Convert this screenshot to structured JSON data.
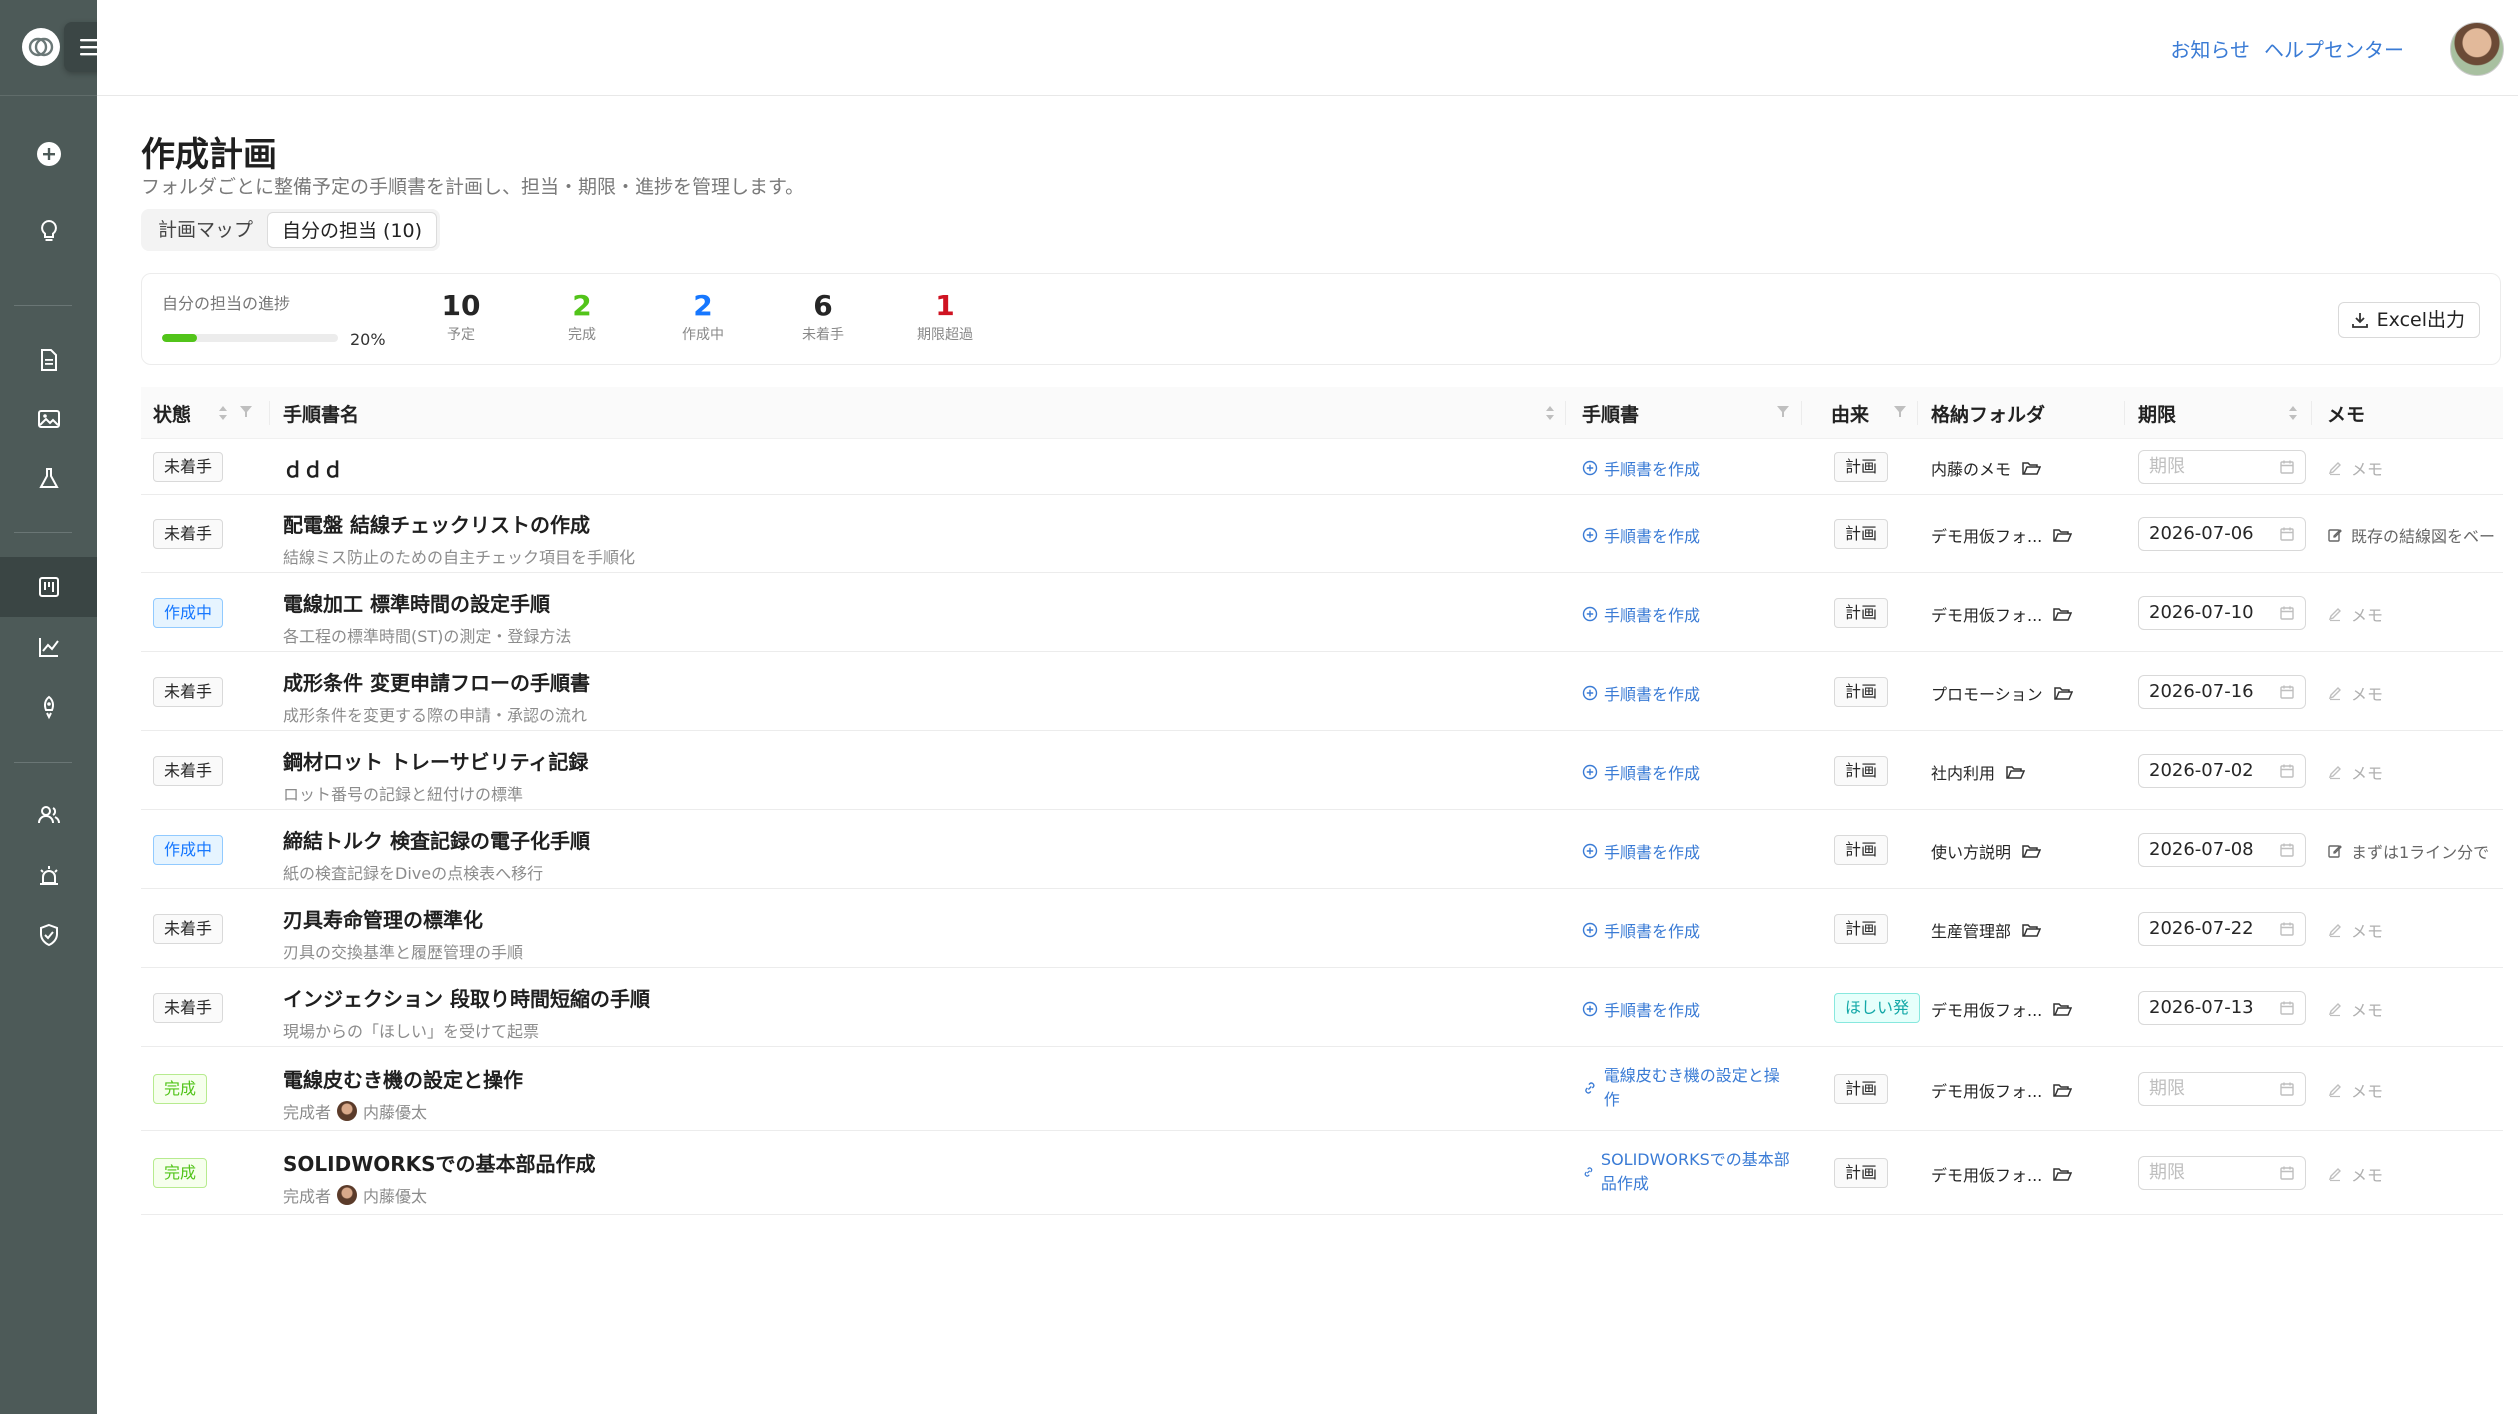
{
  "header": {
    "notice": "お知らせ",
    "help": "ヘルプセンター"
  },
  "page": {
    "title": "作成計画",
    "description": "フォルダごとに整備予定の手順書を計画し、担当・期限・進捗を管理します。",
    "tabs": [
      "計画マップ",
      "自分の担当 (10)"
    ],
    "active_tab": 1
  },
  "progress": {
    "label": "自分の担当の進捗",
    "percent_text": "20%",
    "fraction": 0.2
  },
  "stats": [
    {
      "value": "10",
      "label": "予定",
      "color": "#262626"
    },
    {
      "value": "2",
      "label": "完成",
      "color": "#52c41a"
    },
    {
      "value": "2",
      "label": "作成中",
      "color": "#1677ff"
    },
    {
      "value": "6",
      "label": "未着手",
      "color": "#262626"
    },
    {
      "value": "1",
      "label": "期限超過",
      "color": "#cf1322"
    }
  ],
  "excel_button": "Excel出力",
  "table": {
    "headers": {
      "status": "状態",
      "name": "手順書名",
      "doc": "手順書",
      "origin": "由来",
      "folder": "格納フォルダ",
      "deadline": "期限",
      "memo": "メモ"
    },
    "rows": [
      {
        "status": "未着手",
        "status_kind": "todo",
        "title": "ｄｄｄ",
        "sub": "",
        "completer": "",
        "doc": "手順書を作成",
        "doc_kind": "create",
        "origin": "計画",
        "origin_kind": "plan",
        "folder": "内藤のメモ",
        "date": "期限",
        "date_empty": true,
        "memo": "メモ",
        "memo_filled": false
      },
      {
        "status": "未着手",
        "status_kind": "todo",
        "title": "配電盤 結線チェックリストの作成",
        "sub": "結線ミス防止のための自主チェック項目を手順化",
        "completer": "",
        "doc": "手順書を作成",
        "doc_kind": "create",
        "origin": "計画",
        "origin_kind": "plan",
        "folder": "デモ用仮フォ...",
        "date": "2026-07-06",
        "date_empty": false,
        "memo": "既存の結線図をベー",
        "memo_filled": true
      },
      {
        "status": "作成中",
        "status_kind": "doing",
        "title": "電線加工 標準時間の設定手順",
        "sub": "各工程の標準時間(ST)の測定・登録方法",
        "completer": "",
        "doc": "手順書を作成",
        "doc_kind": "create",
        "origin": "計画",
        "origin_kind": "plan",
        "folder": "デモ用仮フォ...",
        "date": "2026-07-10",
        "date_empty": false,
        "memo": "メモ",
        "memo_filled": false
      },
      {
        "status": "未着手",
        "status_kind": "todo",
        "title": "成形条件 変更申請フローの手順書",
        "sub": "成形条件を変更する際の申請・承認の流れ",
        "completer": "",
        "doc": "手順書を作成",
        "doc_kind": "create",
        "origin": "計画",
        "origin_kind": "plan",
        "folder": "プロモーション",
        "date": "2026-07-16",
        "date_empty": false,
        "memo": "メモ",
        "memo_filled": false
      },
      {
        "status": "未着手",
        "status_kind": "todo",
        "title": "鋼材ロット トレーサビリティ記録",
        "sub": "ロット番号の記録と紐付けの標準",
        "completer": "",
        "doc": "手順書を作成",
        "doc_kind": "create",
        "origin": "計画",
        "origin_kind": "plan",
        "folder": "社内利用",
        "date": "2026-07-02",
        "date_empty": false,
        "memo": "メモ",
        "memo_filled": false
      },
      {
        "status": "作成中",
        "status_kind": "doing",
        "title": "締結トルク 検査記録の電子化手順",
        "sub": "紙の検査記録をDiveの点検表へ移行",
        "completer": "",
        "doc": "手順書を作成",
        "doc_kind": "create",
        "origin": "計画",
        "origin_kind": "plan",
        "folder": "使い方説明",
        "date": "2026-07-08",
        "date_empty": false,
        "memo": "まずは1ライン分で",
        "memo_filled": true
      },
      {
        "status": "未着手",
        "status_kind": "todo",
        "title": "刃具寿命管理の標準化",
        "sub": "刃具の交換基準と履歴管理の手順",
        "completer": "",
        "doc": "手順書を作成",
        "doc_kind": "create",
        "origin": "計画",
        "origin_kind": "plan",
        "folder": "生産管理部",
        "date": "2026-07-22",
        "date_empty": false,
        "memo": "メモ",
        "memo_filled": false
      },
      {
        "status": "未着手",
        "status_kind": "todo",
        "title": "インジェクション 段取り時間短縮の手順",
        "sub": "現場からの「ほしい」を受けて起票",
        "completer": "",
        "doc": "手順書を作成",
        "doc_kind": "create",
        "origin": "ほしい発",
        "origin_kind": "want",
        "folder": "デモ用仮フォ...",
        "date": "2026-07-13",
        "date_empty": false,
        "memo": "メモ",
        "memo_filled": false
      },
      {
        "status": "完成",
        "status_kind": "done",
        "title": "電線皮むき機の設定と操作",
        "sub": "完成者",
        "completer": "内藤優太",
        "doc": "電線皮むき機の設定と操作",
        "doc_kind": "link",
        "origin": "計画",
        "origin_kind": "plan",
        "folder": "デモ用仮フォ...",
        "date": "期限",
        "date_empty": true,
        "memo": "メモ",
        "memo_filled": false
      },
      {
        "status": "完成",
        "status_kind": "done",
        "title": "SOLIDWORKSでの基本部品作成",
        "sub": "完成者",
        "completer": "内藤優太",
        "doc": "SOLIDWORKSでの基本部品作成",
        "doc_kind": "link",
        "origin": "計画",
        "origin_kind": "plan",
        "folder": "デモ用仮フォ...",
        "date": "期限",
        "date_empty": true,
        "memo": "メモ",
        "memo_filled": false
      }
    ]
  }
}
